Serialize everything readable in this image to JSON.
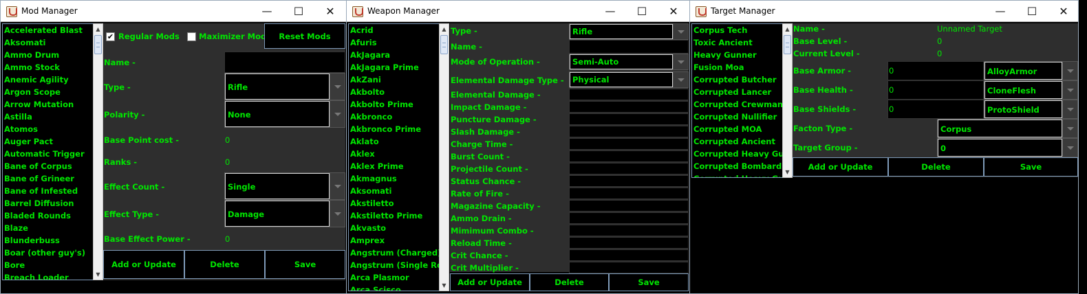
{
  "mod": {
    "title": "Mod Manager",
    "items": [
      "Accelerated Blast",
      "Aksomati",
      "Ammo Drum",
      "Ammo Stock",
      "Anemic Agility",
      "Argon Scope",
      "Arrow Mutation",
      "Astilla",
      "Atomos",
      "Auger Pact",
      "Automatic Trigger",
      "Bane of Corpus",
      "Bane of Grineer",
      "Bane of Infested",
      "Barrel Diffusion",
      "Bladed Rounds",
      "Blaze",
      "Blunderbuss",
      "Boar (other guy's)",
      "Bore",
      "Breach Loader"
    ],
    "regular_label": "Regular Mods",
    "maximizer_label": "Maximizer Mods",
    "reset_label": "Reset Mods",
    "name_label": "Name -",
    "type_label": "Type -",
    "type_value": "Rifle",
    "polarity_label": "Polarity -",
    "polarity_value": "None",
    "base_point_label": "Base Point cost -",
    "base_point_value": "0",
    "ranks_label": "Ranks -",
    "ranks_value": "0",
    "effect_count_label": "Effect Count -",
    "effect_count_value": "Single",
    "effect_type_label": "Effect Type -",
    "effect_type_value": "Damage",
    "base_effect_label": "Base Effect Power -",
    "base_effect_value": "0",
    "add_label": "Add or Update",
    "delete_label": "Delete",
    "save_label": "Save"
  },
  "weapon": {
    "title": "Weapon Manager",
    "items": [
      "Acrid",
      "Afuris",
      "AkJagara",
      "AkJagara Prime",
      "AkZani",
      "Akbolto",
      "Akbolto Prime",
      "Akbronco",
      "Akbronco Prime",
      "Aklato",
      "Aklex",
      "Aklex Prime",
      "Akmagnus",
      "Aksomati",
      "Akstiletto",
      "Akstiletto Prime",
      "Akvasto",
      "Amprex",
      "Angstrum (Charged)",
      "Angstrum (Single Rock",
      "Arca Plasmor",
      "Arca Scisco"
    ],
    "type_label": "Type -",
    "type_value": "Rifle",
    "name_label": "Name -",
    "mode_label": "Mode of Operation -",
    "mode_value": "Semi-Auto",
    "elem_type_label": "Elemental Damage Type -",
    "elem_type_value": "Physical",
    "fields": [
      "Elemental Damage -",
      "Impact Damage -",
      "Puncture Damage -",
      "Slash Damage -",
      "Charge Time -",
      "Burst Count -",
      "Projectile Count -",
      "Status Chance -",
      "Rate of Fire -",
      "Magazine Capacity -",
      "Ammo Drain -",
      "Mimimum Combo -",
      "Reload Time -",
      "Crit Chance -",
      "Crit Multiplier -"
    ],
    "add_label": "Add or Update",
    "delete_label": "Delete",
    "save_label": "Save"
  },
  "target": {
    "title": "Target Manager",
    "items": [
      "Corpus Tech",
      "Toxic Ancient",
      "Heavy Gunner",
      "Fusion Moa",
      "Corrupted Butcher",
      "Corrupted Lancer",
      "Corrupted Crewman",
      "Corrupted Nullifier",
      "Corrupted MOA",
      "Corrupted Ancient",
      "Corrupted Heavy Gunn",
      "Corrupted Bombard",
      "Corrupted Heavy Gunn"
    ],
    "name_label": "Name -",
    "name_value": "Unnamed Target",
    "base_level_label": "Base Level -",
    "base_level_value": "0",
    "current_level_label": "Current Level -",
    "current_level_value": "0",
    "armor_label": "Base Armor -",
    "armor_value": "0",
    "armor_type": "AlloyArmor",
    "health_label": "Base Health -",
    "health_value": "0",
    "health_type": "CloneFlesh",
    "shields_label": "Base Shields -",
    "shields_value": "0",
    "shields_type": "ProtoShield",
    "faction_label": "Facton Type -",
    "faction_value": "Corpus",
    "group_label": "Target Group -",
    "group_value": "0",
    "add_label": "Add or Update",
    "delete_label": "Delete",
    "save_label": "Save"
  },
  "window_controls": {
    "minimize": "—",
    "maximize": "☐",
    "close": "✕"
  }
}
